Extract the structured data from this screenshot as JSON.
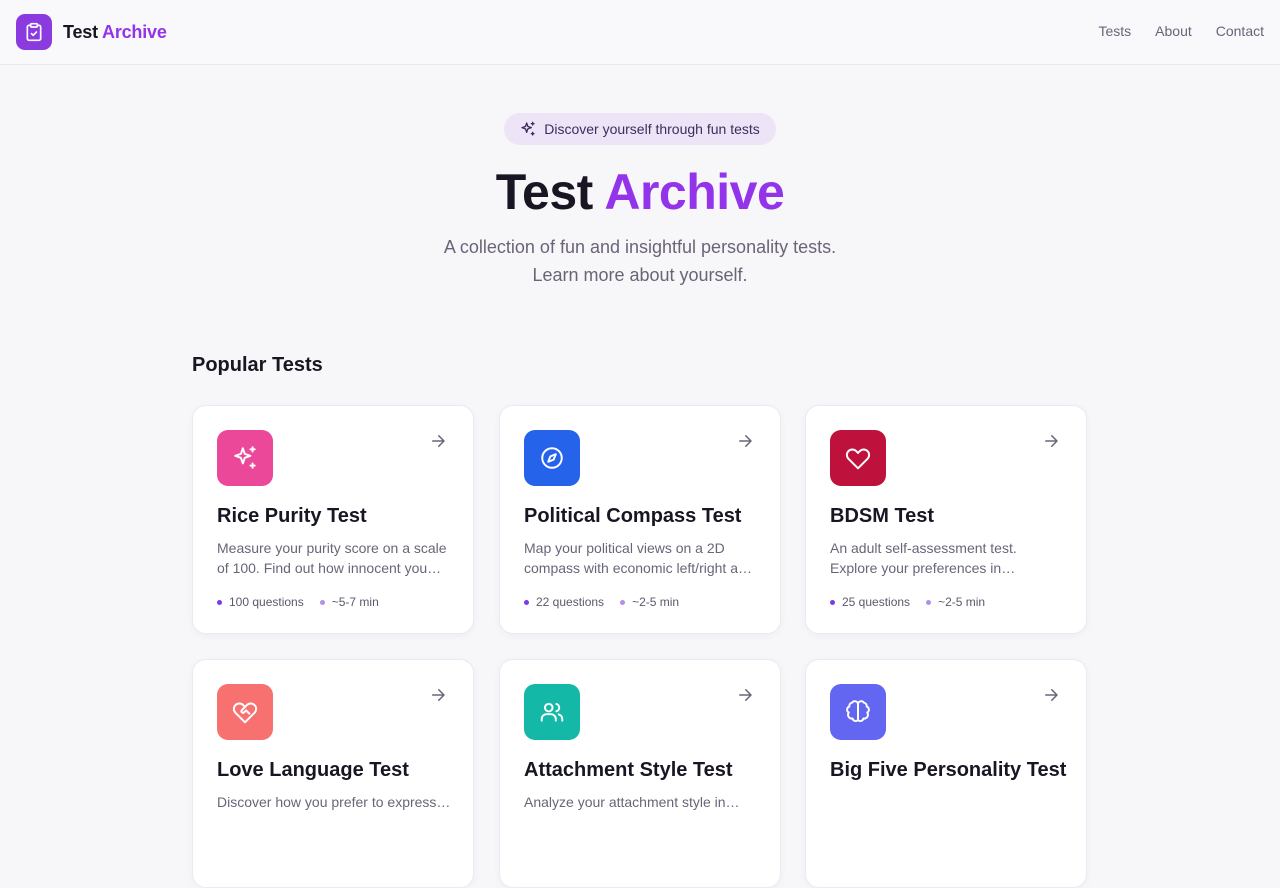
{
  "header": {
    "brand_first": "Test",
    "brand_accent": "Archive",
    "nav": [
      "Tests",
      "About",
      "Contact"
    ]
  },
  "hero": {
    "pill": "Discover yourself through fun tests",
    "title_first": "Test",
    "title_accent": "Archive",
    "subtitle_line1": "A collection of fun and insightful personality tests.",
    "subtitle_line2": "Learn more about yourself."
  },
  "section": {
    "title": "Popular Tests"
  },
  "cards": [
    {
      "title": "Rice Purity Test",
      "desc": "Measure your purity score on a scale of 100. Find out how innocent you…",
      "questions": "100 questions",
      "time": "~5-7 min",
      "color": "#ec4899",
      "icon": "sparkles-icon"
    },
    {
      "title": "Political Compass Test",
      "desc": "Map your political views on a 2D compass with economic left/right a…",
      "questions": "22 questions",
      "time": "~2-5 min",
      "color": "#2563eb",
      "icon": "compass-icon"
    },
    {
      "title": "BDSM Test",
      "desc": "An adult self-assessment test. Explore your preferences in…",
      "questions": "25 questions",
      "time": "~2-5 min",
      "color": "#be123c",
      "icon": "heart-icon"
    },
    {
      "title": "Love Language Test",
      "desc": "Discover how you prefer to express…",
      "color": "#f87171",
      "icon": "heart-handshake-icon"
    },
    {
      "title": "Attachment Style Test",
      "desc": "Analyze your attachment style in…",
      "color": "#14b8a6",
      "icon": "users-icon"
    },
    {
      "title": "Big Five Personality Test",
      "desc": "",
      "color": "#6366f1",
      "icon": "brain-icon"
    }
  ],
  "colors": {
    "accent": "#9333ea",
    "logo_bg": "#8b3ae0"
  }
}
